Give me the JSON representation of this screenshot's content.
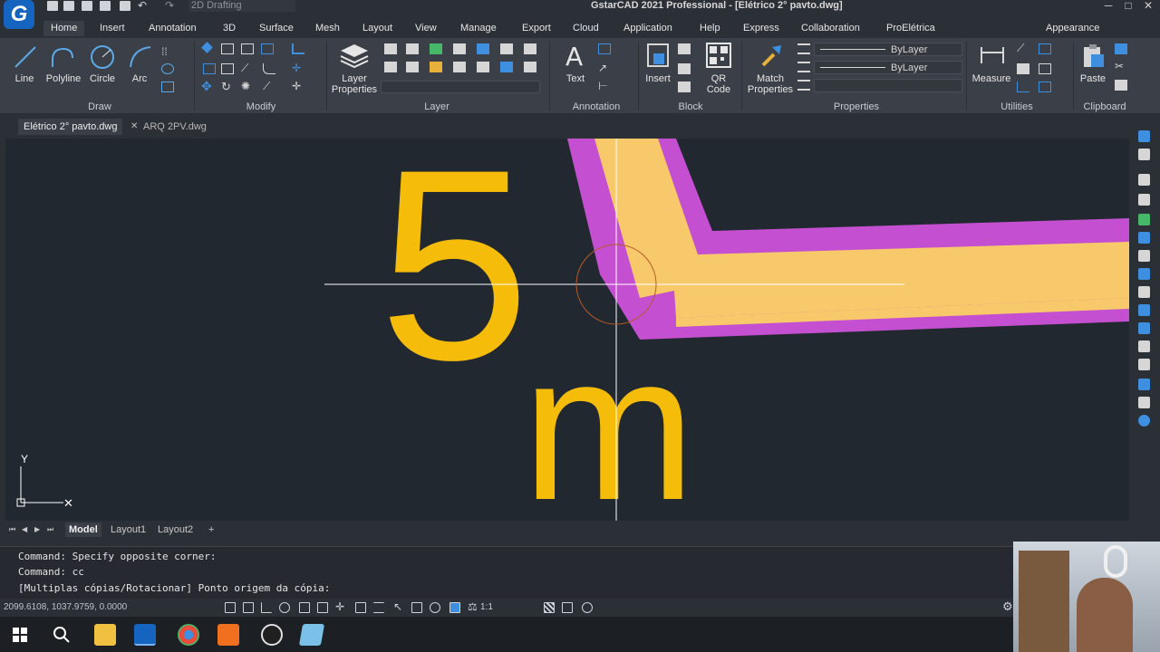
{
  "window": {
    "title": "GstarCAD 2021 Professional - [Elétrico 2° pavto.dwg]",
    "workspace": "2D Drafting",
    "logo": "G",
    "controls": {
      "minimize": "─",
      "restore": "□",
      "close": "✕"
    }
  },
  "menu": {
    "tabs": [
      "Home",
      "Insert",
      "Annotation",
      "3D",
      "Surface",
      "Mesh",
      "Layout",
      "View",
      "Manage",
      "Export",
      "Cloud",
      "Application",
      "Help",
      "Express",
      "Collaboration",
      "ProElétrica"
    ],
    "active": "Home",
    "appearance": "Appearance"
  },
  "ribbon": {
    "draw": {
      "title": "Draw",
      "line": "Line",
      "polyline": "Polyline",
      "circle": "Circle",
      "arc": "Arc"
    },
    "modify": {
      "title": "Modify"
    },
    "layer": {
      "title": "Layer",
      "properties_label_1": "Layer",
      "properties_label_2": "Properties"
    },
    "annotation": {
      "title": "Annotation",
      "text": "Text"
    },
    "block": {
      "title": "Block",
      "insert": "Insert",
      "qr_1": "QR",
      "qr_2": "Code"
    },
    "properties": {
      "title": "Properties",
      "match_1": "Match",
      "match_2": "Properties",
      "bylayer_1": "ByLayer",
      "bylayer_2": "ByLayer"
    },
    "utilities": {
      "title": "Utilities",
      "measure": "Measure"
    },
    "clipboard": {
      "title": "Clipboard",
      "paste": "Paste"
    }
  },
  "documents": {
    "tabs": [
      {
        "label": "Elétrico 2° pavto.dwg",
        "active": true
      },
      {
        "label": "ARQ 2PV.dwg",
        "active": false
      }
    ],
    "close_glyph": "✕"
  },
  "canvas": {
    "text_5": "5",
    "text_m": "m",
    "ucs_y": "Y",
    "ucs_x": "✕",
    "colors": {
      "background": "#212830",
      "text": "#f5bd0a",
      "fill": "#f8c96a",
      "outline": "#c44fd0",
      "cursor": "#ffffff",
      "aperture": "#b85a2a"
    }
  },
  "layouts": {
    "tabs": [
      "Model",
      "Layout1",
      "Layout2"
    ],
    "active": "Model",
    "add": "+",
    "nav": [
      "⏮",
      "◀",
      "▶",
      "⏭"
    ]
  },
  "command": {
    "lines": [
      "Command: Specify opposite corner:",
      "Command: cc",
      "[Multiplas cópias/Rotacionar] Ponto origem da cópia:"
    ]
  },
  "status": {
    "coordinates": "2099.6108, 1037.9759, 0.0000",
    "scale": "1:1"
  }
}
